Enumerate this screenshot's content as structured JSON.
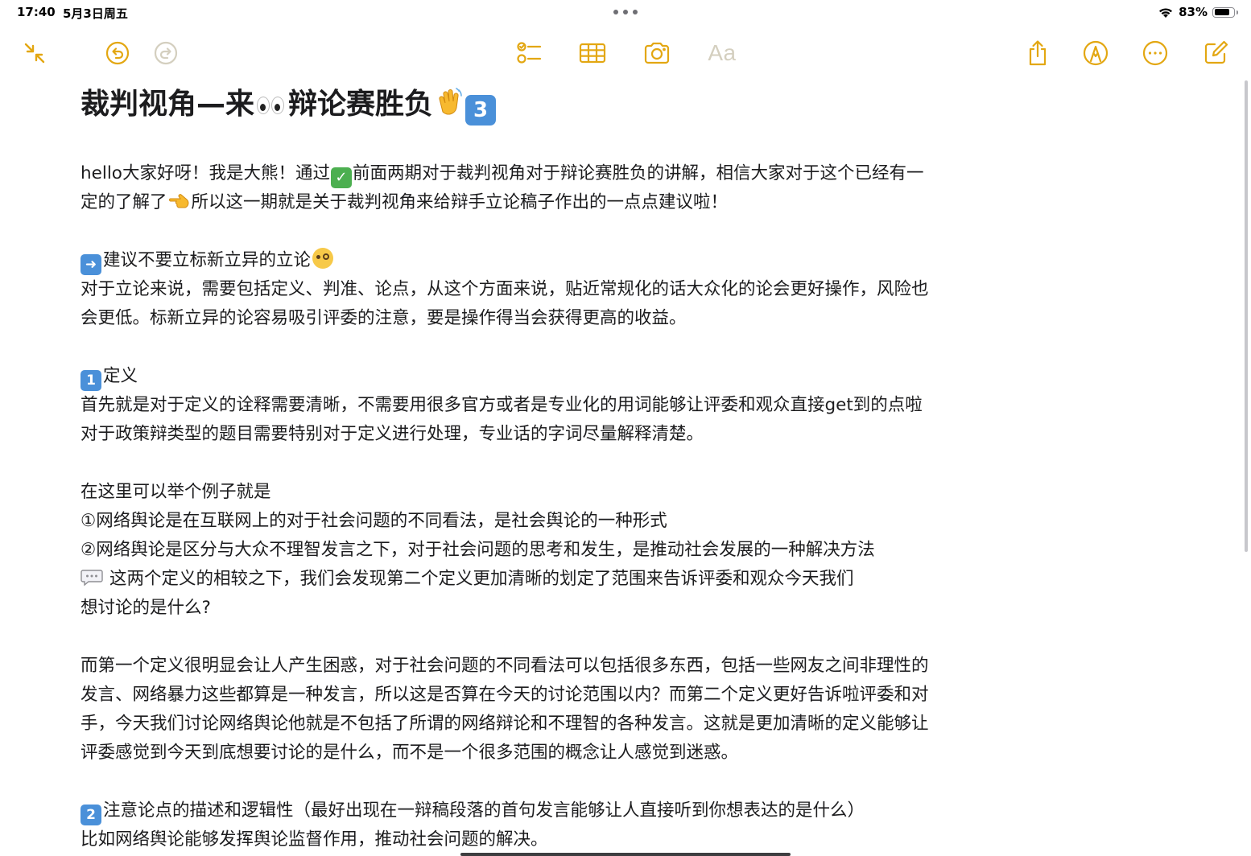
{
  "status_bar": {
    "time": "17:40",
    "date": "5月3日周五",
    "battery": "83%",
    "battery_level": 0.83
  },
  "toolbar": {
    "icons": [
      "collapse-icon",
      "undo-icon",
      "redo-icon",
      "checklist-icon",
      "table-icon",
      "camera-icon",
      "text-format-icon",
      "share-icon",
      "markup-icon",
      "more-icon",
      "compose-icon"
    ],
    "text_format_label": "Aa",
    "accent_color": "#e3a712",
    "disabled_color": "#d4cfbf"
  },
  "note": {
    "title_part1": "裁判视角—来",
    "title_part2": "辩论赛胜负",
    "title_keycap": "3",
    "intro_line1_a": "hello大家好呀！我是大熊！通过",
    "intro_line1_b": "前面两期对于裁判视角对于辩论赛胜负的讲解，相信大家对于这个已经有一",
    "intro_line2_a": "定的了解了",
    "intro_line2_b": "所以这一期就是关于裁判视角来给辩手立论稿子作出的一点点建议啦！",
    "section_a_heading": "建议不要立标新立异的立论",
    "section_a_line1": "对于立论来说，需要包括定义、判准、论点，从这个方面来说，贴近常规化的话大众化的论会更好操作，风险也",
    "section_a_line2": "会更低。标新立异的论容易吸引评委的注意，要是操作得当会获得更高的收益。",
    "section_1_keycap": "1",
    "section_1_heading": "定义",
    "section_1_line1": "首先就是对于定义的诠释需要清晰，不需要用很多官方或者是专业化的用词能够让评委和观众直接get到的点啦",
    "section_1_line2": "对于政策辩类型的题目需要特别对于定义进行处理，专业话的字词尽量解释清楚。",
    "example_intro": "在这里可以举个例子就是",
    "example_1": "①网络舆论是在互联网上的对于社会问题的不同看法，是社会舆论的一种形式",
    "example_2": "②网络舆论是区分与大众不理智发言之下，对于社会问题的思考和发生，是推动社会发展的一种解决方法",
    "comment_line1": "这两个定义的相较之下，我们会发现第二个定义更加清晰的划定了范围来告诉评委和观众今天我们",
    "comment_line2": "想讨论的是什么?",
    "para_line1": "而第一个定义很明显会让人产生困惑，对于社会问题的不同看法可以包括很多东西，包括一些网友之间非理性的",
    "para_line2": "发言、网络暴力这些都算是一种发言，所以这是否算在今天的讨论范围以内？而第二个定义更好告诉啦评委和对",
    "para_line3": "手，今天我们讨论网络舆论他就是不包括了所谓的网络辩论和不理智的各种发言。这就是更加清晰的定义能够让",
    "para_line4": "评委感觉到今天到底想要讨论的是什么，而不是一个很多范围的概念让人感觉到迷惑。",
    "section_2_keycap": "2",
    "section_2_heading": "注意论点的描述和逻辑性（最好出现在一辩稿段落的首句发言能够让人直接听到你想表达的是什么）",
    "section_2_line1": "比如网络舆论能够发挥舆论监督作用，推动社会问题的解决。"
  }
}
